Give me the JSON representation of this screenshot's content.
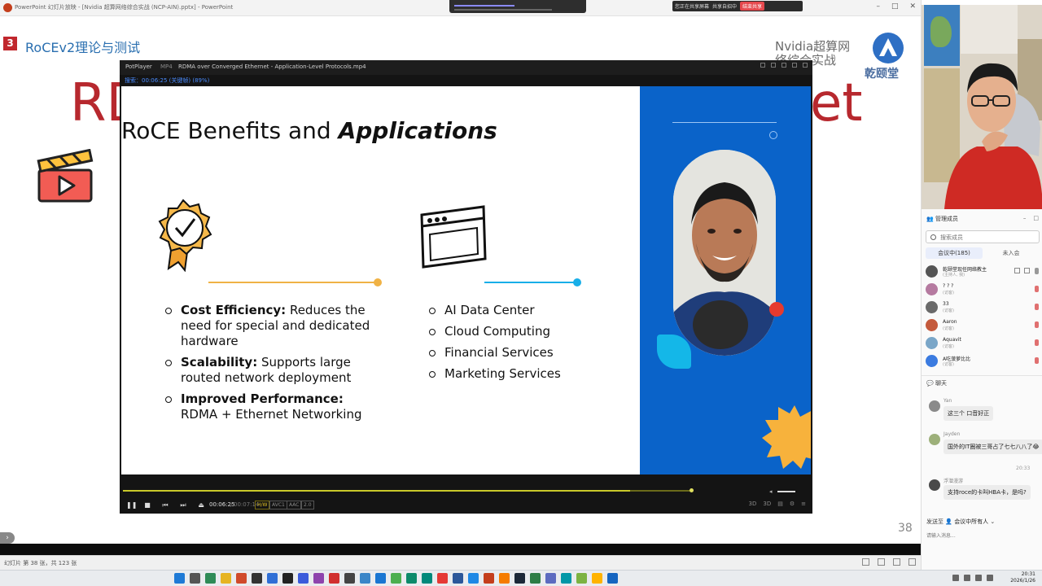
{
  "powerpoint": {
    "window_title": "PowerPoint 幻灯片放映 - [Nvidia 超算网络综合实战 (NCP-AIN).pptx] - PowerPoint",
    "status_text": "幻灯片 第 38 张，共 123 张",
    "slide": {
      "section_number": "3",
      "section_title": "RoCEv2理论与测试",
      "big_title_left": "RD",
      "big_title_right": "et",
      "brand_line1": "Nvidia超算网",
      "brand_line2": "络综合实战",
      "brand_name": "乾颐堂",
      "page_number": "38"
    }
  },
  "share_bar": {
    "sharing_label": "您正在共享屏幕",
    "status_label": "共享自招中",
    "stop_label": "结束共享"
  },
  "player": {
    "app_name": "PotPlayer",
    "format": "MP4",
    "file_name": "RDMA over Converged Ethernet - Application-Level Protocols.mp4",
    "osd_text": "搜索：00:06:25 (关键帧) (89%)",
    "time_current": "00:06:25",
    "time_separator": "/",
    "time_total": "00:07:14",
    "progress_fraction": 0.89,
    "tags": {
      "hw": "H/W",
      "avc": "AVC1",
      "aac": "AAC",
      "ch": "2.0"
    },
    "right_controls": [
      "3D",
      "3D"
    ],
    "video": {
      "title_plain": "RoCE Benefits and ",
      "title_emph": "Applications",
      "benefits": [
        {
          "bold": "Cost Efficiency:",
          "rest": " Reduces the need for special and dedicated hardware"
        },
        {
          "bold": "Scalability:",
          "rest": " Supports large routed network deployment"
        },
        {
          "bold": "Improved Performance:",
          "rest": " RDMA + Ethernet Networking"
        }
      ],
      "applications": [
        "AI Data Center",
        "Cloud Computing",
        "Financial Services",
        "Marketing Services"
      ]
    }
  },
  "meeting": {
    "members_header": "管理成员",
    "search_placeholder": "搜索成员",
    "tab_in_meeting": "会议中(185)",
    "tab_not_joined": "未入会",
    "members": [
      {
        "name": "乾颐堂现任网络教主",
        "role": "(主持人, 我)"
      },
      {
        "name": "? ? ?",
        "role": "(访客)"
      },
      {
        "name": "33",
        "role": "(访客)"
      },
      {
        "name": "Aaron",
        "role": "(访客)"
      },
      {
        "name": "Aquavit",
        "role": "(访客)"
      },
      {
        "name": "A吃菠萝比比",
        "role": "(访客)"
      }
    ],
    "chat_header": "聊天",
    "messages": [
      {
        "name": "Yan",
        "text": "这三个 口音好正"
      },
      {
        "name": "Jayden",
        "text": "国外的IT圈被三哥占了七七八八了😂"
      },
      {
        "name": "浮潜漫游",
        "text": "支持roce的卡叫HBA卡，是吗?"
      }
    ],
    "chat_time": "20:33",
    "send_to_label": "发送至",
    "send_to_target": "会议中所有人",
    "input_placeholder": "请输入消息..."
  },
  "taskbar": {
    "time": "20:31",
    "date": "2026/1/26"
  },
  "colors": {
    "slide_red": "#b7282e",
    "section_blue": "#2a6fb0",
    "video_blue": "#0a63c9",
    "accent_orange": "#f0b245",
    "accent_cyan": "#18aee8",
    "seek_yellow": "#c9c92a"
  }
}
